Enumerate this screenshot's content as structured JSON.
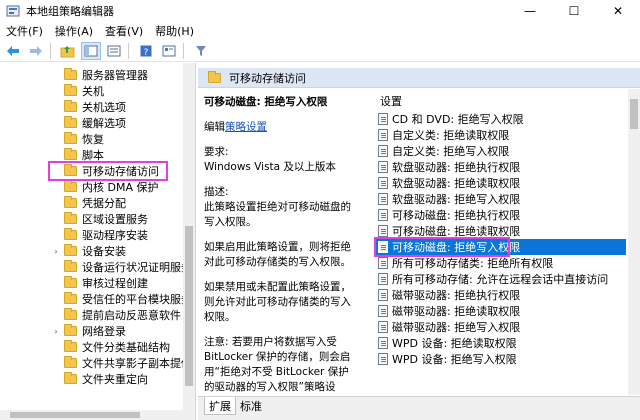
{
  "window": {
    "title": "本地组策略编辑器",
    "controls": {
      "minimize": "—",
      "maximize": "☐",
      "close": "✕"
    }
  },
  "menu": [
    "文件(F)",
    "操作(A)",
    "查看(V)",
    "帮助(H)"
  ],
  "toolbar": {
    "icons": [
      "back-icon",
      "forward-icon",
      "folder-up-icon",
      "show-hide-tree-icon",
      "export-list-icon",
      "help-icon",
      "properties-icon",
      "filter-icon"
    ]
  },
  "tree": {
    "items": [
      {
        "label": "服务器管理器",
        "expander": ""
      },
      {
        "label": "关机",
        "expander": ""
      },
      {
        "label": "关机选项",
        "expander": ""
      },
      {
        "label": "缓解选项",
        "expander": ""
      },
      {
        "label": "恢复",
        "expander": ""
      },
      {
        "label": "脚本",
        "expander": ""
      },
      {
        "label": "可移动存储访问",
        "expander": "",
        "selected": true
      },
      {
        "label": "内核 DMA 保护",
        "expander": ""
      },
      {
        "label": "凭据分配",
        "expander": ""
      },
      {
        "label": "区域设置服务",
        "expander": ""
      },
      {
        "label": "驱动程序安装",
        "expander": ""
      },
      {
        "label": "设备安装",
        "expander": "›"
      },
      {
        "label": "设备运行状况证明服务",
        "expander": ""
      },
      {
        "label": "审核过程创建",
        "expander": ""
      },
      {
        "label": "受信任的平台模块服务",
        "expander": ""
      },
      {
        "label": "提前启动反恶意软件",
        "expander": ""
      },
      {
        "label": "网络登录",
        "expander": "›"
      },
      {
        "label": "文件分类基础结构",
        "expander": ""
      },
      {
        "label": "文件共享影子副本提供",
        "expander": ""
      },
      {
        "label": "文件夹重定向",
        "expander": ""
      }
    ]
  },
  "panel": {
    "title": "可移动存储访问"
  },
  "description": {
    "policy_title": "可移动磁盘: 拒绝写入权限",
    "edit_prefix": "编辑",
    "edit_link": "策略设置",
    "requirements_label": "要求:",
    "requirements_value": "Windows Vista 及以上版本",
    "desc_label": "描述:",
    "desc_text": "此策略设置拒绝对可移动磁盘的写入权限。",
    "enabled_text": "如果启用此策略设置，则将拒绝对此可移动存储类的写入权限。",
    "disabled_text": "如果禁用或未配置此策略设置，则允许对此可移动存储类的写入权限。",
    "note_text": "注意: 若要用户将数据写入受 BitLocker 保护的存储，则会启用“拒绝对不受 BitLocker 保护的驱动器的写入权限”策略设置，该设置"
  },
  "settings_list": {
    "header": "设置",
    "items": [
      "CD 和 DVD: 拒绝写入权限",
      "自定义类: 拒绝读取权限",
      "自定义类: 拒绝写入权限",
      "软盘驱动器: 拒绝执行权限",
      "软盘驱动器: 拒绝读取权限",
      "软盘驱动器: 拒绝写入权限",
      "可移动磁盘: 拒绝执行权限",
      "可移动磁盘: 拒绝读取权限",
      "可移动磁盘: 拒绝写入权限",
      "所有可移动存储类: 拒绝所有权限",
      "所有可移动存储: 允许在远程会话中直接访问",
      "磁带驱动器: 拒绝执行权限",
      "磁带驱动器: 拒绝读取权限",
      "磁带驱动器: 拒绝写入权限",
      "WPD 设备: 拒绝读取权限",
      "WPD 设备: 拒绝写入权限"
    ],
    "selected_index": 8
  },
  "tabs": [
    "扩展",
    "标准"
  ]
}
